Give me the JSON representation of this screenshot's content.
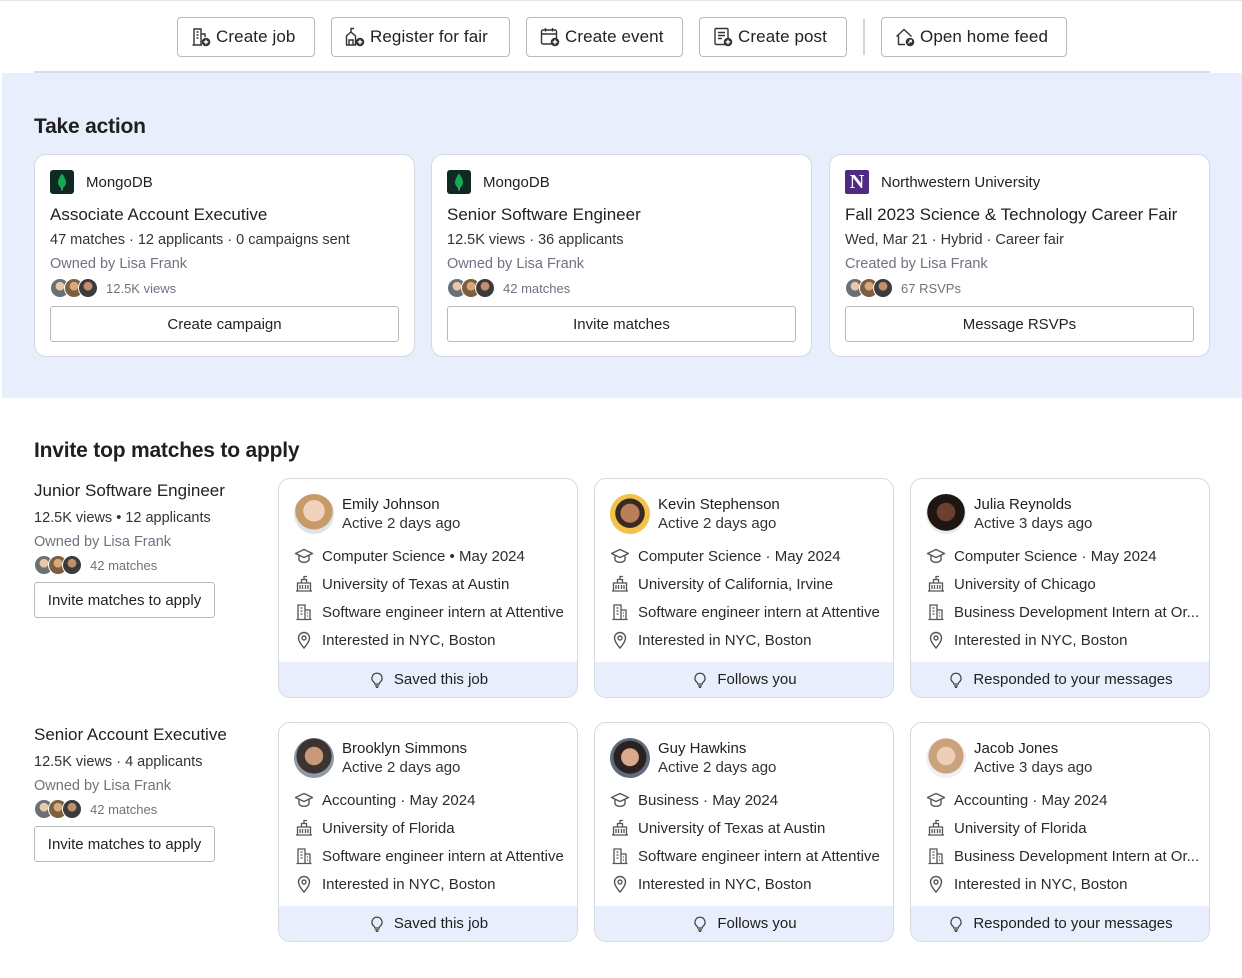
{
  "toolbar": {
    "buttons": [
      {
        "label": "Create job",
        "icon": "building-plus-icon"
      },
      {
        "label": "Register for fair",
        "icon": "fair-plus-icon"
      },
      {
        "label": "Create event",
        "icon": "calendar-plus-icon"
      },
      {
        "label": "Create post",
        "icon": "post-plus-icon"
      },
      {
        "label": "Open home feed",
        "icon": "home-icon"
      }
    ]
  },
  "take_action": {
    "title": "Take action",
    "cards": [
      {
        "org": "MongoDB",
        "title": "Associate Account Executive",
        "meta": "47 matches · 12 applicants · 0 campaigns sent",
        "owner": "Owned by Lisa Frank",
        "avatars_label": "12.5K views",
        "button": "Create campaign"
      },
      {
        "org": "MongoDB",
        "title": "Senior Software Engineer",
        "meta": "12.5K views · 36 applicants",
        "owner": "Owned by Lisa Frank",
        "avatars_label": "42 matches",
        "button": "Invite matches"
      },
      {
        "org": "Northwestern University",
        "title": "Fall 2023 Science & Technology Career Fair",
        "meta": "Wed, Mar 21 · Hybrid · Career fair",
        "owner": "Created by Lisa Frank",
        "avatars_label": "67 RSVPs",
        "button": "Message RSVPs"
      }
    ]
  },
  "invite": {
    "title": "Invite top matches to apply",
    "jobs": [
      {
        "title": "Junior Software Engineer",
        "meta": "12.5K views • 12 applicants",
        "owner": "Owned by Lisa Frank",
        "avatars_label": "42 matches",
        "button": "Invite matches to apply",
        "matches": [
          {
            "name": "Emily Johnson",
            "active": "Active 2 days ago",
            "study": "Computer Science • May 2024",
            "school": "University of Texas at Austin",
            "work": "Software engineer intern at Attentive",
            "interest": "Interested in NYC, Boston",
            "reason": "Saved this job"
          },
          {
            "name": "Kevin Stephenson",
            "active": "Active 2 days ago",
            "study": "Computer Science · May 2024",
            "school": "University of California, Irvine",
            "work": "Software engineer intern at Attentive",
            "interest": "Interested in NYC, Boston",
            "reason": "Follows you"
          },
          {
            "name": "Julia Reynolds",
            "active": "Active 3 days ago",
            "study": "Computer Science · May 2024",
            "school": "University of Chicago",
            "work": "Business Development Intern at Or...",
            "interest": "Interested in NYC, Boston",
            "reason": "Responded to your messages"
          }
        ]
      },
      {
        "title": "Senior Account Executive",
        "meta": "12.5K views · 4 applicants",
        "owner": "Owned by Lisa Frank",
        "avatars_label": "42 matches",
        "button": "Invite matches to apply",
        "matches": [
          {
            "name": "Brooklyn Simmons",
            "active": "Active 2 days ago",
            "study": "Accounting · May 2024",
            "school": "University of Florida",
            "work": "Software engineer intern at Attentive",
            "interest": "Interested in NYC, Boston",
            "reason": "Saved this job"
          },
          {
            "name": "Guy Hawkins",
            "active": "Active 2 days ago",
            "study": "Business · May 2024",
            "school": "University of Texas at Austin",
            "work": "Software engineer intern at Attentive",
            "interest": "Interested in NYC, Boston",
            "reason": "Follows you"
          },
          {
            "name": "Jacob Jones",
            "active": "Active 3 days ago",
            "study": "Accounting · May 2024",
            "school": "University of Florida",
            "work": "Business Development Intern at Or...",
            "interest": "Interested in NYC, Boston",
            "reason": "Responded to your messages"
          }
        ]
      }
    ]
  }
}
